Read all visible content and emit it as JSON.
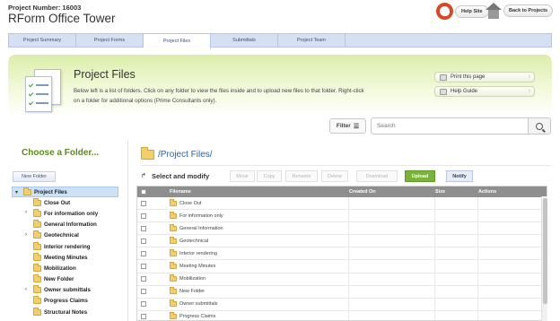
{
  "header": {
    "project_number": "Project Number: 16003",
    "project_name": "RForm Office Tower",
    "help_site": "Help Site",
    "back_to_projects": "Back to Projects"
  },
  "tabs": [
    {
      "label": "Project Summary"
    },
    {
      "label": "Project Forms"
    },
    {
      "label": "Project Files",
      "active": true
    },
    {
      "label": "Submittals"
    },
    {
      "label": "Project Team"
    }
  ],
  "banner": {
    "title": "Project Files",
    "description": "Below left is a list of folders. Click on any folder to view the files inside and to upload new files to that folder. Right-click on a folder for additional options (Prime Consultants only).",
    "print_label": "Print this page",
    "help_guide_label": "Help Guide"
  },
  "filter": {
    "label": "Filter"
  },
  "search": {
    "placeholder": "Search"
  },
  "left": {
    "title": "Choose a Folder...",
    "new_folder": "New Folder",
    "root": "Project Files",
    "folders": [
      {
        "label": "Close Out",
        "expandable": false
      },
      {
        "label": "For information only",
        "expandable": true
      },
      {
        "label": "General Information",
        "expandable": false
      },
      {
        "label": "Geotechnical",
        "expandable": true
      },
      {
        "label": "Interior rendering",
        "expandable": false
      },
      {
        "label": "Meeting Minutes",
        "expandable": false
      },
      {
        "label": "Mobilization",
        "expandable": false
      },
      {
        "label": "New Folder",
        "expandable": false
      },
      {
        "label": "Owner submittals",
        "expandable": true
      },
      {
        "label": "Progress Claims",
        "expandable": false
      },
      {
        "label": "Structural Notes",
        "expandable": false
      }
    ]
  },
  "main": {
    "path": "/Project Files/",
    "select_label": "Select and modify",
    "actions": {
      "move": "Move",
      "copy": "Copy",
      "rename": "Rename",
      "delete": "Delete",
      "download": "Download",
      "upload": "Upload",
      "notify": "Notify"
    },
    "columns": {
      "filename": "Filename",
      "created": "Created On",
      "size": "Size",
      "actions": "Actions"
    },
    "rows": [
      "Close Out",
      "For information only",
      "General Information",
      "Geotechnical",
      "Interior rendering",
      "Meeting Minutes",
      "Mobilization",
      "New Folder",
      "Owner submittals",
      "Progress Claims"
    ]
  },
  "colors": {
    "accent_green": "#7ab33b",
    "title_green": "#5d8a1e",
    "link_blue": "#2f5fa8",
    "tab_bg": "#d6e0f3"
  }
}
